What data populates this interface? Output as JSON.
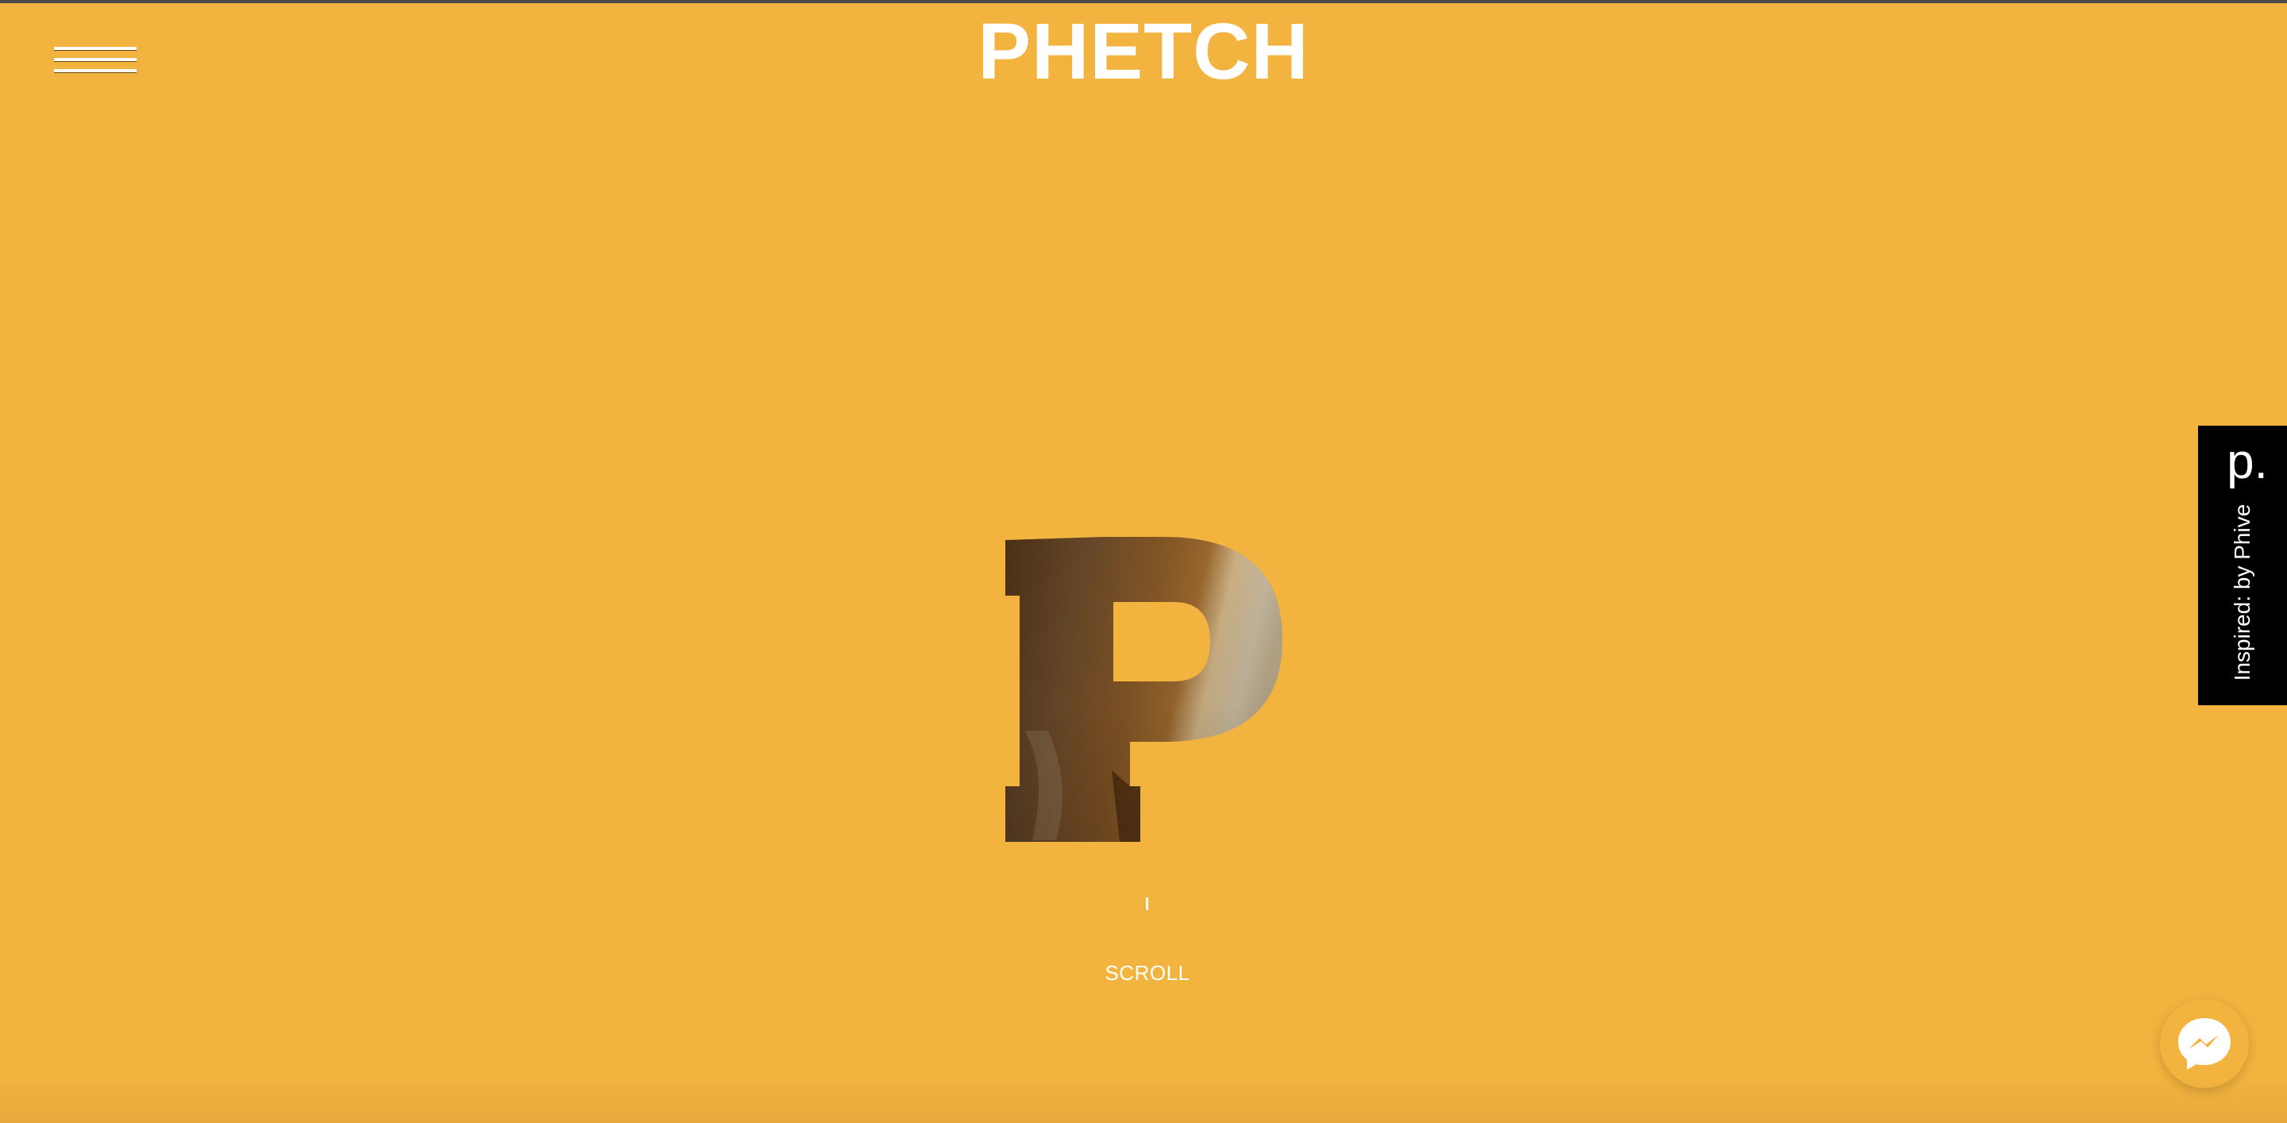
{
  "header": {
    "title": "PHETCH",
    "menu_icon": "hamburger-menu-icon"
  },
  "hero": {
    "letter": "P",
    "scroll_label": "SCROLL"
  },
  "side_tab": {
    "logo": "p.",
    "text": "Inspired: by Phive"
  },
  "chat": {
    "icon": "messenger-icon"
  },
  "colors": {
    "background": "#f3b43f",
    "text": "#ffffff",
    "side_tab_bg": "#000000"
  }
}
